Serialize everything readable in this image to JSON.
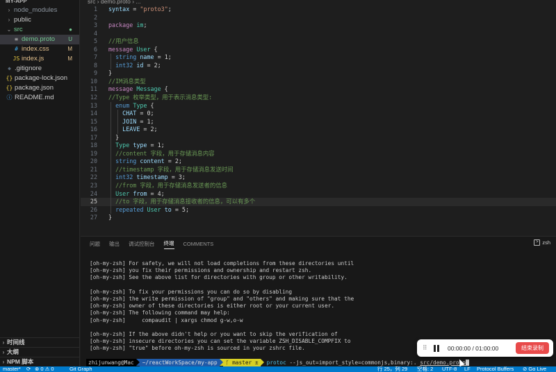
{
  "sidebar": {
    "header": "MY-APP",
    "items": [
      {
        "label": "node_modules",
        "icon": "folder-chevron-icon",
        "indent": 1,
        "chevron": "›",
        "badge": "",
        "color": "#8b949e"
      },
      {
        "label": "public",
        "icon": "folder-chevron-icon",
        "indent": 1,
        "chevron": "›",
        "badge": "",
        "color": "#cccccc"
      },
      {
        "label": "src",
        "icon": "folder-open-icon",
        "indent": 1,
        "chevron": "⌄",
        "badge": "●",
        "color": "#73c991"
      },
      {
        "label": "demo.proto",
        "icon": "proto-file-icon",
        "indent": 2,
        "chevron": "",
        "badge": "U",
        "color": "#73c991",
        "glyph": "≡",
        "glyphColor": "#c0c0c0",
        "active": true
      },
      {
        "label": "index.css",
        "icon": "css-file-icon",
        "indent": 2,
        "chevron": "",
        "badge": "M",
        "color": "#e2c08d",
        "glyph": "#",
        "glyphColor": "#3ea7e6"
      },
      {
        "label": "index.js",
        "icon": "js-file-icon",
        "indent": 2,
        "chevron": "",
        "badge": "M",
        "color": "#e2c08d",
        "glyph": "JS",
        "glyphColor": "#e8c941"
      },
      {
        "label": ".gitignore",
        "icon": "git-file-icon",
        "indent": 1,
        "chevron": "",
        "badge": "",
        "color": "#cccccc",
        "glyph": "◆",
        "glyphColor": "#5a6a7a"
      },
      {
        "label": "package-lock.json",
        "icon": "json-file-icon",
        "indent": 1,
        "chevron": "",
        "badge": "",
        "color": "#cccccc",
        "glyph": "{}",
        "glyphColor": "#e8c941"
      },
      {
        "label": "package.json",
        "icon": "json-file-icon",
        "indent": 1,
        "chevron": "",
        "badge": "",
        "color": "#cccccc",
        "glyph": "{}",
        "glyphColor": "#e8c941"
      },
      {
        "label": "README.md",
        "icon": "info-file-icon",
        "indent": 1,
        "chevron": "",
        "badge": "",
        "color": "#cccccc",
        "glyph": "ⓘ",
        "glyphColor": "#4aa0e6"
      }
    ],
    "bottom_sections": [
      "时间线",
      "大纲",
      "NPM 脚本"
    ]
  },
  "editor": {
    "breadcrumb": "src › demo.proto › ...",
    "current_line": 25,
    "lines": [
      {
        "n": "1",
        "indent": 0,
        "tokens": [
          [
            "syntax",
            "#9cdcfe"
          ],
          [
            " = ",
            "#d4d4d4"
          ],
          [
            "\"proto3\"",
            "#ce9178"
          ],
          [
            ";",
            "#d4d4d4"
          ]
        ]
      },
      {
        "n": "2",
        "indent": 0,
        "tokens": []
      },
      {
        "n": "3",
        "indent": 0,
        "tokens": [
          [
            "package",
            "#c586c0"
          ],
          [
            " ",
            "#d4d4d4"
          ],
          [
            "im",
            "#4ec9b0"
          ],
          [
            ";",
            "#d4d4d4"
          ]
        ]
      },
      {
        "n": "4",
        "indent": 0,
        "tokens": []
      },
      {
        "n": "5",
        "indent": 0,
        "tokens": [
          [
            "//用户信息",
            "#6a9955"
          ]
        ]
      },
      {
        "n": "6",
        "indent": 0,
        "tokens": [
          [
            "message",
            "#c586c0"
          ],
          [
            " ",
            "#d4d4d4"
          ],
          [
            "User",
            "#4ec9b0"
          ],
          [
            " {",
            "#d4d4d4"
          ]
        ]
      },
      {
        "n": "7",
        "indent": 1,
        "tokens": [
          [
            "  string",
            "#569cd6"
          ],
          [
            " ",
            "#d4d4d4"
          ],
          [
            "name",
            "#9cdcfe"
          ],
          [
            " = 1;",
            "#d4d4d4"
          ]
        ]
      },
      {
        "n": "8",
        "indent": 1,
        "tokens": [
          [
            "  int32",
            "#569cd6"
          ],
          [
            " ",
            "#d4d4d4"
          ],
          [
            "id",
            "#9cdcfe"
          ],
          [
            " = 2;",
            "#d4d4d4"
          ]
        ]
      },
      {
        "n": "9",
        "indent": 0,
        "tokens": [
          [
            "}",
            "#d4d4d4"
          ]
        ]
      },
      {
        "n": "10",
        "indent": 0,
        "tokens": [
          [
            "//IM消息类型",
            "#6a9955"
          ]
        ]
      },
      {
        "n": "11",
        "indent": 0,
        "tokens": [
          [
            "message",
            "#c586c0"
          ],
          [
            " ",
            "#d4d4d4"
          ],
          [
            "Message",
            "#4ec9b0"
          ],
          [
            " {",
            "#d4d4d4"
          ]
        ]
      },
      {
        "n": "12",
        "indent": 0,
        "tokens": [
          [
            "//Type 枚举类型，用于表示消息类型:",
            "#6a9955"
          ]
        ]
      },
      {
        "n": "13",
        "indent": 1,
        "tokens": [
          [
            "  enum",
            "#569cd6"
          ],
          [
            " ",
            "#d4d4d4"
          ],
          [
            "Type",
            "#4ec9b0"
          ],
          [
            " {",
            "#d4d4d4"
          ]
        ]
      },
      {
        "n": "14",
        "indent": 2,
        "tokens": [
          [
            "    CHAT",
            "#9cdcfe"
          ],
          [
            " = 0;",
            "#d4d4d4"
          ]
        ]
      },
      {
        "n": "15",
        "indent": 2,
        "tokens": [
          [
            "    JOIN",
            "#9cdcfe"
          ],
          [
            " = 1;",
            "#d4d4d4"
          ]
        ]
      },
      {
        "n": "16",
        "indent": 2,
        "tokens": [
          [
            "    LEAVE",
            "#9cdcfe"
          ],
          [
            " = 2;",
            "#d4d4d4"
          ]
        ]
      },
      {
        "n": "17",
        "indent": 1,
        "tokens": [
          [
            "  }",
            "#d4d4d4"
          ]
        ]
      },
      {
        "n": "18",
        "indent": 1,
        "tokens": [
          [
            "  Type",
            "#4ec9b0"
          ],
          [
            " ",
            "#d4d4d4"
          ],
          [
            "type",
            "#9cdcfe"
          ],
          [
            " = 1;",
            "#d4d4d4"
          ]
        ]
      },
      {
        "n": "19",
        "indent": 1,
        "tokens": [
          [
            "  //content 字段，用于存储消息内容",
            "#6a9955"
          ]
        ]
      },
      {
        "n": "20",
        "indent": 1,
        "tokens": [
          [
            "  string",
            "#569cd6"
          ],
          [
            " ",
            "#d4d4d4"
          ],
          [
            "content",
            "#9cdcfe"
          ],
          [
            " = 2;",
            "#d4d4d4"
          ]
        ]
      },
      {
        "n": "21",
        "indent": 1,
        "tokens": [
          [
            "  //timestamp 字段，用于存储消息发送时间",
            "#6a9955"
          ]
        ]
      },
      {
        "n": "22",
        "indent": 1,
        "tokens": [
          [
            "  int32",
            "#569cd6"
          ],
          [
            " ",
            "#d4d4d4"
          ],
          [
            "timestamp",
            "#9cdcfe"
          ],
          [
            " = 3;",
            "#d4d4d4"
          ]
        ]
      },
      {
        "n": "23",
        "indent": 1,
        "tokens": [
          [
            "  //from 字段，用于存储消息发送者的信息",
            "#6a9955"
          ]
        ]
      },
      {
        "n": "24",
        "indent": 1,
        "tokens": [
          [
            "  User",
            "#4ec9b0"
          ],
          [
            " ",
            "#d4d4d4"
          ],
          [
            "from",
            "#9cdcfe"
          ],
          [
            " = 4;",
            "#d4d4d4"
          ]
        ]
      },
      {
        "n": "25",
        "indent": 1,
        "tokens": [
          [
            "  //to 字段，用于存储消息接收者的信息，可以有多个",
            "#6a9955"
          ]
        ]
      },
      {
        "n": "26",
        "indent": 1,
        "tokens": [
          [
            "  repeated",
            "#569cd6"
          ],
          [
            " ",
            "#d4d4d4"
          ],
          [
            "User",
            "#4ec9b0"
          ],
          [
            " ",
            "#d4d4d4"
          ],
          [
            "to",
            "#9cdcfe"
          ],
          [
            " = 5;",
            "#d4d4d4"
          ]
        ]
      },
      {
        "n": "27",
        "indent": 0,
        "tokens": [
          [
            "}",
            "#d4d4d4"
          ]
        ]
      }
    ]
  },
  "panel": {
    "tabs": [
      "问题",
      "输出",
      "调试控制台",
      "终端",
      "COMMENTS"
    ],
    "active_tab": "终端",
    "shell_label": "zsh",
    "terminal_lines": [
      "[oh-my-zsh] For safety, we will not load completions from these directories until",
      "[oh-my-zsh] you fix their permissions and ownership and restart zsh.",
      "[oh-my-zsh] See the above list for directories with group or other writability.",
      "",
      "[oh-my-zsh] To fix your permissions you can do so by disabling",
      "[oh-my-zsh] the write permission of \"group\" and \"others\" and making sure that the",
      "[oh-my-zsh] owner of these directories is either root or your current user.",
      "[oh-my-zsh] The following command may help:",
      "[oh-my-zsh]     compaudit | xargs chmod g-w,o-w",
      "",
      "[oh-my-zsh] If the above didn't help or you want to skip the verification of",
      "[oh-my-zsh] insecure directories you can set the variable ZSH_DISABLE_COMPFIX to",
      "[oh-my-zsh] \"true\" before oh-my-zsh is sourced in your zshrc file."
    ],
    "prompt": {
      "user": "zhijunwang@Mac",
      "dir": "~/reactWorkSpace/my-app",
      "git": "master ±",
      "cmd_name": "protoc",
      "cmd_args": " --js_out=import_style=commonjs,binary:. ",
      "cmd_path": "src/demo.proto"
    }
  },
  "recorder": {
    "time": "00:00:00 / 01:00:00",
    "stop_label": "结束录制"
  },
  "statusbar": {
    "branch": "master*",
    "problems": "⊗ 0 ⚠ 0",
    "gitgraph": "Git Graph",
    "position": "行 25，列 29",
    "spaces": "空格: 2",
    "encoding": "UTF-8",
    "eol": "LF",
    "language": "Protocol Buffers",
    "golive": "⊘ Go Live"
  }
}
